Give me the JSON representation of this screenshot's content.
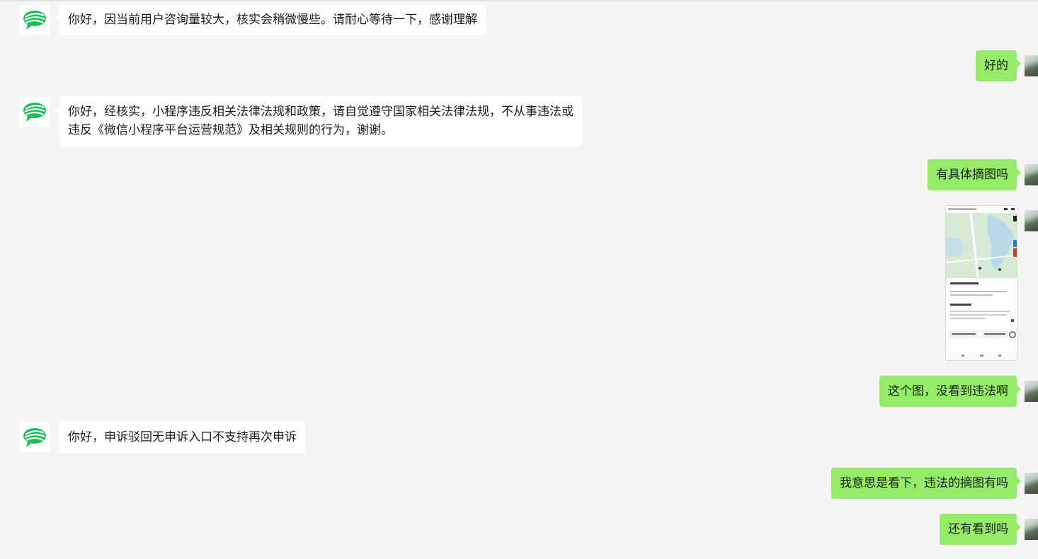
{
  "conversation": {
    "messages": [
      {
        "sender": "official",
        "text": "你好，因当前用户咨询量较大，核实会稍微慢些。请耐心等待一下，感谢理解"
      },
      {
        "sender": "user",
        "text": "好的"
      },
      {
        "sender": "official",
        "line1": "你好，经核实，小程序违反相关法律法规和政策，请自觉遵守国家相关法律法规，不从事违法或",
        "line2": "违反《微信小程序平台运营规范》及相关规则的行为，谢谢。"
      },
      {
        "sender": "user",
        "text": "有具体摘图吗"
      },
      {
        "sender": "user",
        "type": "image",
        "description": "map-screenshot"
      },
      {
        "sender": "user",
        "text": "这个图，没看到违法啊"
      },
      {
        "sender": "official",
        "text": "你好，申诉驳回无申诉入口不支持再次申诉"
      },
      {
        "sender": "user",
        "text": "我意思是看下，违法的摘图有吗"
      },
      {
        "sender": "user",
        "text": "还有看到吗"
      }
    ]
  },
  "colors": {
    "background": "#f5f5f5",
    "official_bubble": "#ffffff",
    "user_bubble": "#95ec69",
    "official_logo": "#1dbe5a"
  },
  "icons": {
    "official_avatar": "wechat-team-logo-icon",
    "user_avatar": "landscape-photo-avatar"
  }
}
